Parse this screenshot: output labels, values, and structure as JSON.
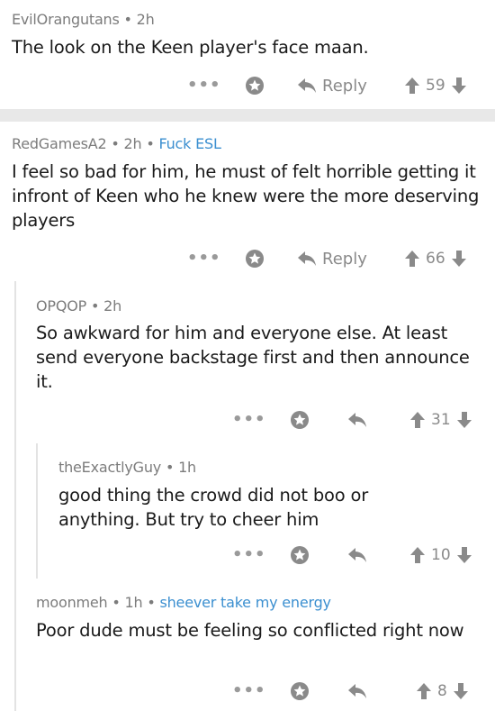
{
  "comments": [
    {
      "author": "EvilOrangutans",
      "sep1": "•",
      "age": "2h",
      "flair": "",
      "body": "The look on the Keen player's face maan.",
      "more": "•••",
      "reply_label": "Reply",
      "score": "59"
    },
    {
      "author": "RedGamesA2",
      "sep1": "•",
      "age": "2h",
      "sep2": "•",
      "flair": "Fuck ESL",
      "body": "I feel so bad for him, he must of felt horrible getting it infront of Keen who he knew were the more deserving players",
      "more": "•••",
      "reply_label": "Reply",
      "score": "66"
    },
    {
      "author": "OPQOP",
      "sep1": "•",
      "age": "2h",
      "flair": "",
      "body": "So awkward for him and everyone else. At least send everyone backstage first and then announce it.",
      "more": "•••",
      "reply_label": "",
      "score": "31"
    },
    {
      "author": "theExactlyGuy",
      "sep1": "•",
      "age": "1h",
      "flair": "",
      "body": "good thing the crowd did not boo or anything. But try to cheer him",
      "more": "•••",
      "reply_label": "",
      "score": "10"
    },
    {
      "author": "moonmeh",
      "sep1": "•",
      "age": "1h",
      "sep2": "•",
      "flair": "sheever take my energy",
      "body": "Poor dude must be feeling so conflicted right now",
      "more": "•••",
      "reply_label": "",
      "score": "8"
    }
  ],
  "icons": {
    "more": "ellipsis-icon",
    "save": "star-outline-icon",
    "reply": "reply-arrow-icon",
    "upvote": "upvote-arrow-icon",
    "downvote": "downvote-arrow-icon"
  },
  "colors": {
    "meta": "#7c7c7c",
    "flair": "#3b8fd0",
    "icons": "#8a8a8a",
    "separator": "#e8e8e8"
  }
}
